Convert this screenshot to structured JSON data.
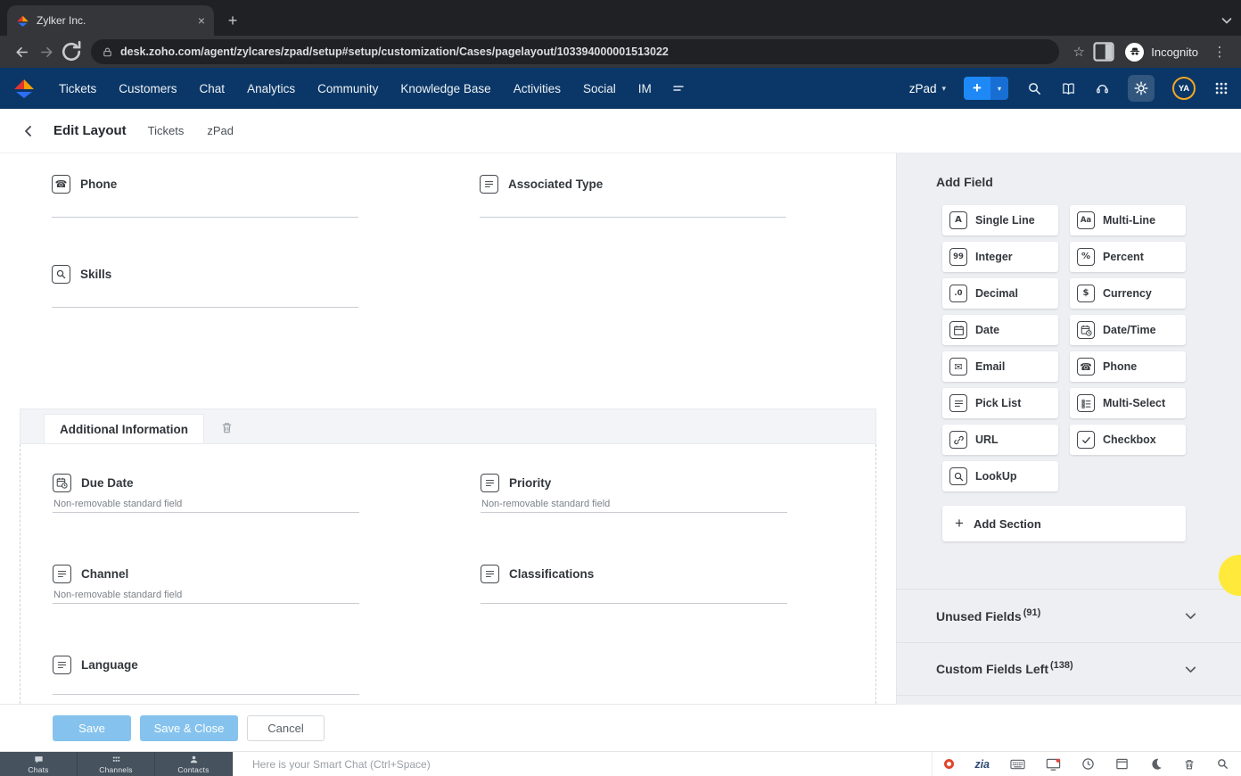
{
  "browser": {
    "tab_title": "Zylker Inc.",
    "url": "desk.zoho.com/agent/zylcares/zpad/setup#setup/customization/Cases/pagelayout/103394000001513022",
    "incognito_label": "Incognito"
  },
  "navbar": {
    "items": [
      {
        "label": "Tickets"
      },
      {
        "label": "Customers"
      },
      {
        "label": "Chat"
      },
      {
        "label": "Analytics"
      },
      {
        "label": "Community"
      },
      {
        "label": "Knowledge Base"
      },
      {
        "label": "Activities"
      },
      {
        "label": "Social"
      },
      {
        "label": "IM"
      }
    ],
    "department_label": "zPad",
    "add_label": "+",
    "avatar_initials": "YA"
  },
  "subheader": {
    "title": "Edit Layout",
    "crumb1": "Tickets",
    "crumb2": "zPad"
  },
  "canvas": {
    "fields": [
      {
        "label": "Phone",
        "icon": "phone"
      },
      {
        "label": "Associated Type",
        "icon": "picklist"
      },
      {
        "label": "Skills",
        "icon": "lookup"
      }
    ],
    "section": {
      "title": "Additional Information",
      "fields": [
        {
          "label": "Due Date",
          "icon": "datetime",
          "note": "Non-removable standard field"
        },
        {
          "label": "Priority",
          "icon": "picklist",
          "note": "Non-removable standard field"
        },
        {
          "label": "Channel",
          "icon": "picklist",
          "note": "Non-removable standard field"
        },
        {
          "label": "Classifications",
          "icon": "picklist",
          "note": ""
        },
        {
          "label": "Language",
          "icon": "picklist",
          "note": ""
        }
      ]
    }
  },
  "panel": {
    "title": "Add Field",
    "field_types": [
      {
        "label": "Single Line",
        "icon": "single-line"
      },
      {
        "label": "Multi-Line",
        "icon": "multi-line"
      },
      {
        "label": "Integer",
        "icon": "integer"
      },
      {
        "label": "Percent",
        "icon": "percent"
      },
      {
        "label": "Decimal",
        "icon": "decimal"
      },
      {
        "label": "Currency",
        "icon": "currency"
      },
      {
        "label": "Date",
        "icon": "date"
      },
      {
        "label": "Date/Time",
        "icon": "datetime"
      },
      {
        "label": "Email",
        "icon": "email"
      },
      {
        "label": "Phone",
        "icon": "phone"
      },
      {
        "label": "Pick List",
        "icon": "picklist"
      },
      {
        "label": "Multi-Select",
        "icon": "multiselect"
      },
      {
        "label": "URL",
        "icon": "url"
      },
      {
        "label": "Checkbox",
        "icon": "checkbox"
      },
      {
        "label": "LookUp",
        "icon": "lookup"
      }
    ],
    "add_section_label": "Add Section",
    "unused_fields_label": "Unused Fields",
    "unused_fields_count": "(91)",
    "custom_fields_label": "Custom Fields Left",
    "custom_fields_count": "(138)"
  },
  "actions": {
    "save": "Save",
    "save_close": "Save & Close",
    "cancel": "Cancel"
  },
  "chatbar": {
    "tabs": [
      {
        "label": "Chats",
        "icon": "chat-bubble"
      },
      {
        "label": "Channels",
        "icon": "channels"
      },
      {
        "label": "Contacts",
        "icon": "contacts"
      }
    ],
    "placeholder": "Here is your Smart Chat (Ctrl+Space)",
    "zia_label": "zia"
  }
}
